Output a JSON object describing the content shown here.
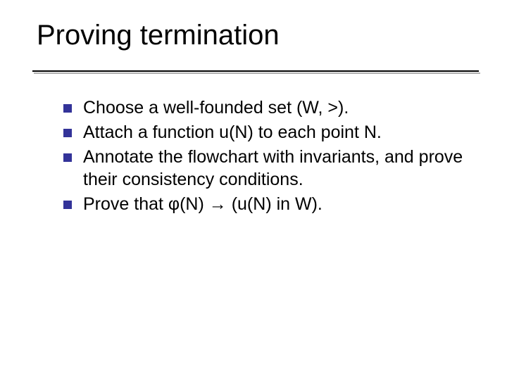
{
  "slide": {
    "title": "Proving termination",
    "bullets": [
      "Choose a well-founded set (W, >).",
      "Attach a function u(N) to each point N.",
      "Annotate the flowchart with invariants, and prove their consistency conditions.",
      "Prove that φ(N) → (u(N) in W)."
    ]
  }
}
